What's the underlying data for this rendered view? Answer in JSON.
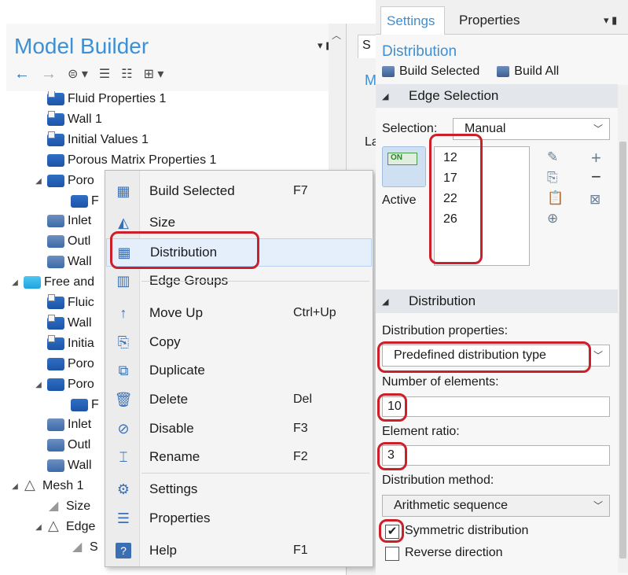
{
  "model_builder": {
    "title": "Model Builder",
    "tree": [
      {
        "label": "Fluid Properties 1",
        "indent": 1,
        "icon": "param"
      },
      {
        "label": "Wall 1",
        "indent": 1,
        "icon": "param"
      },
      {
        "label": "Initial Values 1",
        "indent": 1,
        "icon": "param"
      },
      {
        "label": "Porous Matrix Properties 1",
        "indent": 1,
        "icon": "node"
      },
      {
        "label": "Poro",
        "indent": 1,
        "icon": "node",
        "expand": "◢"
      },
      {
        "label": "F",
        "indent": 2,
        "icon": "node"
      },
      {
        "label": "Inlet",
        "indent": 1,
        "icon": "grey"
      },
      {
        "label": "Outl",
        "indent": 1,
        "icon": "grey"
      },
      {
        "label": "Wall",
        "indent": 1,
        "icon": "grey"
      },
      {
        "label": "Free and",
        "indent": 0,
        "icon": "free",
        "expand": "◢"
      },
      {
        "label": "Fluic",
        "indent": 1,
        "icon": "param"
      },
      {
        "label": "Wall",
        "indent": 1,
        "icon": "param"
      },
      {
        "label": "Initia",
        "indent": 1,
        "icon": "param"
      },
      {
        "label": "Poro",
        "indent": 1,
        "icon": "node"
      },
      {
        "label": "Poro",
        "indent": 1,
        "icon": "node",
        "expand": "◢"
      },
      {
        "label": "F",
        "indent": 2,
        "icon": "node"
      },
      {
        "label": "Inlet",
        "indent": 1,
        "icon": "grey"
      },
      {
        "label": "Outl",
        "indent": 1,
        "icon": "grey"
      },
      {
        "label": "Wall",
        "indent": 1,
        "icon": "grey"
      },
      {
        "label": "Mesh 1",
        "indent": 0,
        "icon": "mesh",
        "expand": "◢"
      },
      {
        "label": "Size",
        "indent": 1,
        "icon": "size"
      },
      {
        "label": "Edge",
        "indent": 1,
        "icon": "mesh",
        "expand": "◢"
      },
      {
        "label": "S",
        "indent": 2,
        "icon": "size"
      }
    ]
  },
  "middle_pane": {
    "tab_letter": "S",
    "m_letter": "M",
    "la_text": "La"
  },
  "context_menu": {
    "items": [
      {
        "label": "Build Selected",
        "shortcut": "F7",
        "icon": "build-selected-icon",
        "glyph": "▦"
      },
      {
        "label": "Size",
        "shortcut": "",
        "icon": "size-icon",
        "glyph": "◭"
      },
      {
        "label": "Distribution",
        "shortcut": "",
        "icon": "distribution-icon",
        "glyph": "▦",
        "highlighted": true
      },
      {
        "label": "Edge Groups",
        "shortcut": "",
        "icon": "edge-groups-icon",
        "glyph": "▥"
      },
      {
        "label": "Move Up",
        "shortcut": "Ctrl+Up",
        "icon": "move-up-icon",
        "glyph": "↑"
      },
      {
        "label": "Copy",
        "shortcut": "",
        "icon": "copy-icon",
        "glyph": "⎘"
      },
      {
        "label": "Duplicate",
        "shortcut": "",
        "icon": "duplicate-icon",
        "glyph": "⧉"
      },
      {
        "label": "Delete",
        "shortcut": "Del",
        "icon": "delete-icon",
        "glyph": "🗑"
      },
      {
        "label": "Disable",
        "shortcut": "F3",
        "icon": "disable-icon",
        "glyph": "⊘"
      },
      {
        "label": "Rename",
        "shortcut": "F2",
        "icon": "rename-icon",
        "glyph": "⌶"
      },
      {
        "label": "Settings",
        "shortcut": "",
        "icon": "settings-icon",
        "glyph": "⚙"
      },
      {
        "label": "Properties",
        "shortcut": "",
        "icon": "properties-icon",
        "glyph": "☰"
      },
      {
        "label": "Help",
        "shortcut": "F1",
        "icon": "help-icon",
        "glyph": "?"
      }
    ]
  },
  "settings": {
    "tabs": [
      "Settings",
      "Properties"
    ],
    "title": "Distribution",
    "build_selected": "Build Selected",
    "build_all": "Build All",
    "edge_selection": {
      "header": "Edge Selection",
      "selection_label": "Selection:",
      "selection_value": "Manual",
      "toggle_text": "ON",
      "active_label": "Active",
      "edges": [
        "12",
        "17",
        "22",
        "26"
      ]
    },
    "distribution": {
      "header": "Distribution",
      "properties_label": "Distribution properties:",
      "properties_value": "Predefined distribution type",
      "num_elements_label": "Number of elements:",
      "num_elements_value": "10",
      "element_ratio_label": "Element ratio:",
      "element_ratio_value": "3",
      "method_label": "Distribution method:",
      "method_value": "Arithmetic sequence",
      "symmetric_label": "Symmetric distribution",
      "symmetric_checked": true,
      "reverse_label": "Reverse direction",
      "reverse_checked": false
    }
  },
  "colors": {
    "accent": "#3f8fd2",
    "annotation_red": "#cc1f2a",
    "highlight": "#e5eefb"
  }
}
